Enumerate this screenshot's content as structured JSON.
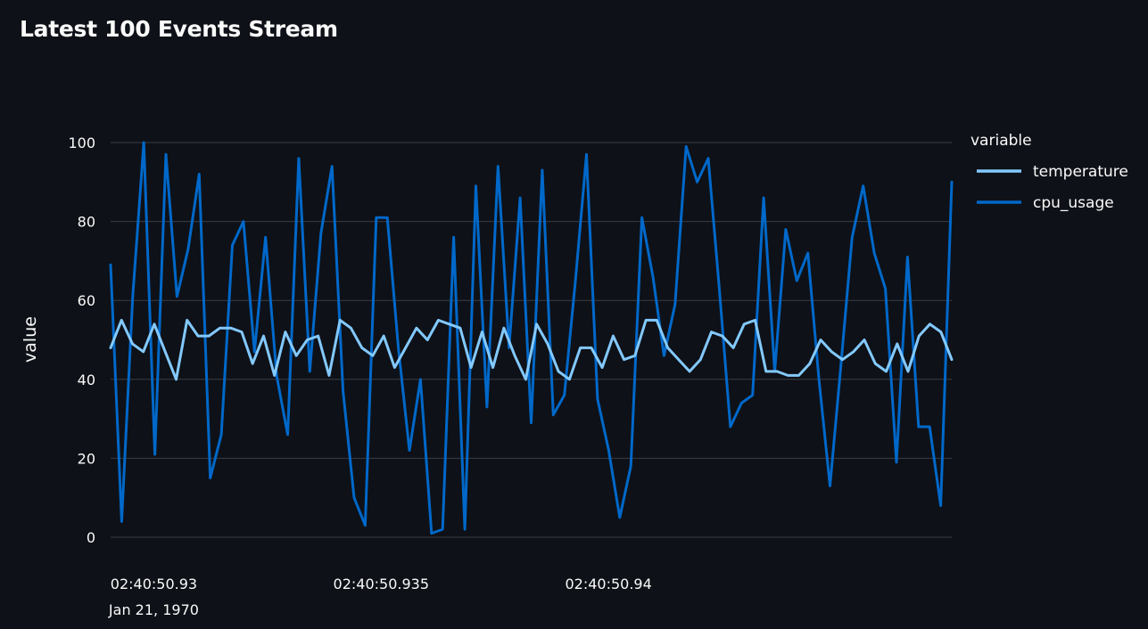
{
  "page": {
    "title": "Latest 100 Events Stream"
  },
  "chart_data": {
    "type": "line",
    "ylabel": "value",
    "xlabel": "",
    "ylim": [
      0,
      100
    ],
    "y_ticks": [
      0,
      20,
      40,
      60,
      80,
      100
    ],
    "grid": true,
    "legend_title": "variable",
    "legend_position": "right",
    "x_tick_labels": [
      {
        "time": "02:40:50.93",
        "date": "Jan 21, 1970"
      },
      {
        "time": "02:40:50.935",
        "date": ""
      },
      {
        "time": "02:40:50.94",
        "date": ""
      }
    ],
    "x_tick_values": [
      -17.55,
      -12.55,
      -7.55
    ],
    "x_unit": "ms relative to 02:40:50.9475",
    "series": [
      {
        "name": "temperature",
        "color": "#83c9ff",
        "values": [
          48,
          55,
          49,
          47,
          54,
          47,
          40,
          55,
          51,
          51,
          53,
          53,
          52,
          44,
          51,
          41,
          52,
          46,
          50,
          51,
          41,
          55,
          53,
          48,
          46,
          51,
          43,
          48,
          53,
          50,
          55,
          54,
          53,
          43,
          52,
          43,
          53,
          46,
          40,
          54,
          49,
          42,
          40,
          48,
          48,
          43,
          51,
          45,
          46,
          55,
          55,
          48,
          45,
          42,
          45,
          52,
          51,
          48,
          54,
          55,
          42,
          42,
          41,
          41,
          44,
          50,
          47,
          45,
          47,
          50,
          44,
          42,
          49,
          42,
          51,
          54,
          52,
          45
        ]
      },
      {
        "name": "cpu_usage",
        "color": "#0068c9",
        "values": [
          69,
          4,
          61,
          100,
          21,
          97,
          61,
          73,
          92,
          15,
          26,
          74,
          80,
          47,
          76,
          41,
          26,
          96,
          42,
          77,
          94,
          37,
          10,
          3,
          81,
          81,
          48,
          22,
          40,
          1,
          2,
          76,
          2,
          89,
          33,
          94,
          48,
          86,
          29,
          93,
          31,
          36,
          65,
          97,
          35,
          22,
          5,
          18,
          81,
          66,
          46,
          59,
          99,
          90,
          96,
          63,
          28,
          34,
          36,
          86,
          42,
          78,
          65,
          72,
          40,
          13,
          44,
          76,
          89,
          72,
          63,
          19,
          71,
          28,
          28,
          8,
          90
        ]
      }
    ]
  }
}
